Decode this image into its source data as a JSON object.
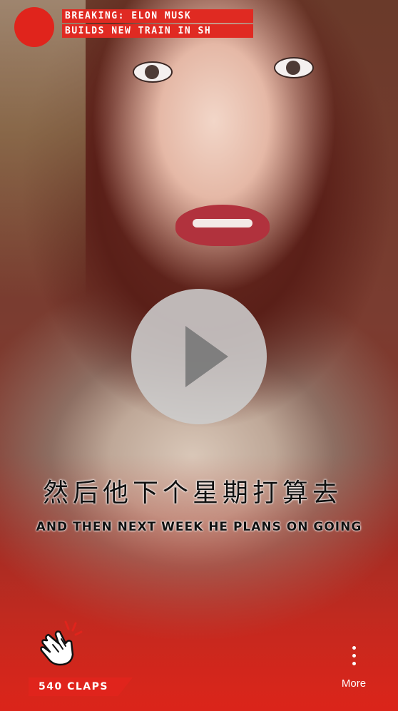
{
  "news": {
    "line1": "BREAKING: ELON MUSK",
    "line2": "BUILDS NEW TRAIN IN SH"
  },
  "captions": {
    "chinese": "然后他下个星期打算去",
    "english": "AND THEN NEXT WEEK HE PLANS ON GOING"
  },
  "claps": {
    "label": "540 CLAPS"
  },
  "more": {
    "label": "More"
  },
  "icons": {
    "record": "record-dot-icon",
    "play": "play-icon",
    "clap": "clapping-hands-icon",
    "more": "vertical-dots-icon"
  },
  "colors": {
    "accent_red": "#e0241c",
    "play_overlay": "#cdcdcd"
  }
}
